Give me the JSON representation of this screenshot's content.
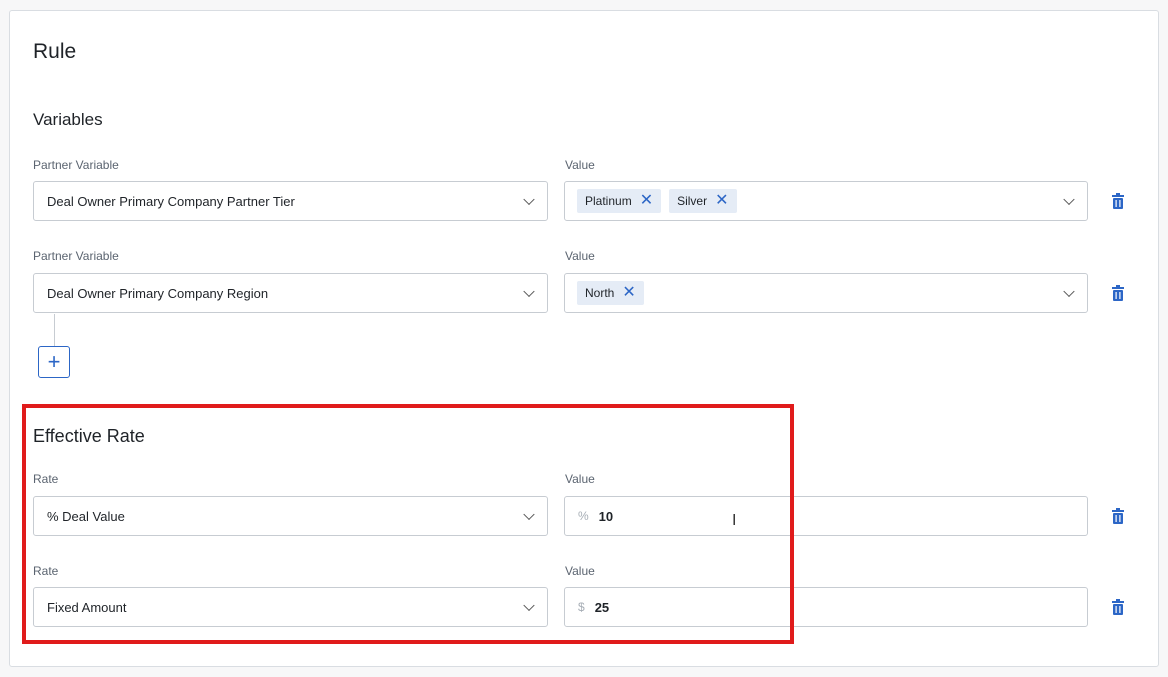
{
  "rule": {
    "title": "Rule"
  },
  "variables": {
    "heading": "Variables",
    "rows": [
      {
        "variable_label": "Partner Variable",
        "variable_value": "Deal Owner Primary Company Partner Tier",
        "value_label": "Value",
        "chips": [
          "Platinum",
          "Silver"
        ]
      },
      {
        "variable_label": "Partner Variable",
        "variable_value": "Deal Owner Primary Company Region",
        "value_label": "Value",
        "chips": [
          "North"
        ]
      }
    ],
    "add_symbol": "+"
  },
  "effective_rate": {
    "heading": "Effective Rate",
    "rows": [
      {
        "rate_label": "Rate",
        "rate_value": "% Deal Value",
        "value_label": "Value",
        "prefix": "%",
        "amount": "10"
      },
      {
        "rate_label": "Rate",
        "rate_value": "Fixed Amount",
        "value_label": "Value",
        "prefix": "$",
        "amount": "25"
      }
    ]
  },
  "colors": {
    "accent": "#2c66c6",
    "highlight": "#e01b1b",
    "chip_bg": "#e5ecf6"
  },
  "icons": {
    "delete": "trash-icon",
    "expand": "chevron-down-icon",
    "remove_chip": "close-icon",
    "add": "plus-icon"
  },
  "cursor_symbol": "I"
}
